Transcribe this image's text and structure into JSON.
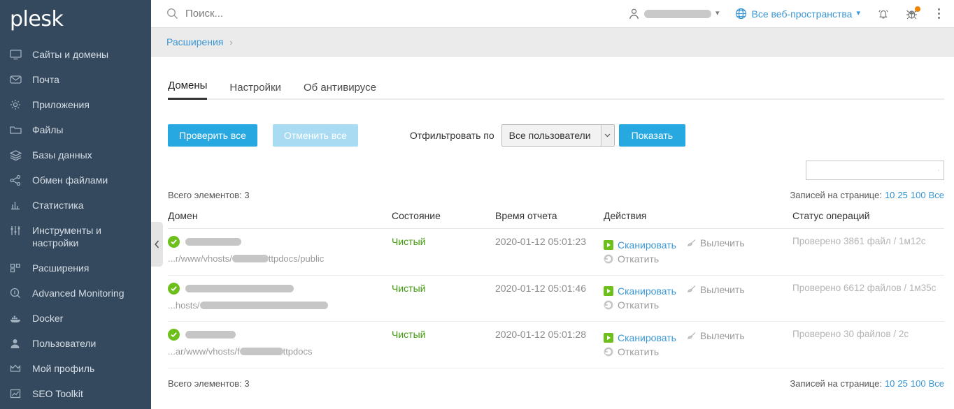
{
  "brand": {
    "name": "plesk"
  },
  "sidebar": {
    "items": [
      {
        "label": "Сайты и домены",
        "icon": "monitor-icon"
      },
      {
        "label": "Почта",
        "icon": "envelope-icon"
      },
      {
        "label": "Приложения",
        "icon": "gear-icon"
      },
      {
        "label": "Файлы",
        "icon": "folder-icon"
      },
      {
        "label": "Базы данных",
        "icon": "database-icon"
      },
      {
        "label": "Обмен файлами",
        "icon": "share-icon"
      },
      {
        "label": "Статистика",
        "icon": "bar-chart-icon"
      },
      {
        "label": "Инструменты и\nнастройки",
        "icon": "sliders-icon"
      },
      {
        "label": "Расширения",
        "icon": "extensions-icon"
      },
      {
        "label": "Advanced Monitoring",
        "icon": "magnifier-circle-icon"
      },
      {
        "label": "Docker",
        "icon": "docker-whale-icon"
      },
      {
        "label": "Пользователи",
        "icon": "user-icon"
      },
      {
        "label": "Мой профиль",
        "icon": "crown-icon"
      },
      {
        "label": "SEO Toolkit",
        "icon": "seo-chart-icon"
      }
    ]
  },
  "topbar": {
    "search_placeholder": "Поиск...",
    "search_value": "",
    "user_redacted": true,
    "webspace_label": "Все веб-пространства",
    "notifications_icon": "bell-icon",
    "bug_icon": "bug-icon",
    "bug_badge": true,
    "more_icon": "kebab-menu-icon"
  },
  "breadcrumb": {
    "items": [
      "Расширения"
    ],
    "separator": "›"
  },
  "tabs": [
    {
      "label": "Домены",
      "active": true
    },
    {
      "label": "Настройки",
      "active": false
    },
    {
      "label": "Об антивирусе",
      "active": false
    }
  ],
  "toolbar": {
    "check_all_label": "Проверить все",
    "cancel_all_label": "Отменить все",
    "filter_label": "Отфильтровать по",
    "filter_value": "Все пользователи",
    "filter_options": [
      "Все пользователи"
    ],
    "show_label": "Показать"
  },
  "list_search": {
    "value": "",
    "placeholder": ""
  },
  "counts": {
    "top_total": "Всего элементов: 3",
    "bottom_total": "Всего элементов: 3",
    "per_page_label": "Записей на странице:",
    "per_page_options": [
      "10",
      "25",
      "100",
      "Все"
    ]
  },
  "table": {
    "headers": [
      "Домен",
      "Состояние",
      "Время отчета",
      "Действия",
      "Статус операций"
    ],
    "rows": [
      {
        "status_icon": "check-circle-icon",
        "domain_redacted_width": 80,
        "path_prefix": "...r/www/vhosts/",
        "path_redacted_width": 52,
        "path_suffix": "ttpdocs/public",
        "state": "Чистый",
        "report_time": "2020-01-12 05:01:23",
        "actions": [
          {
            "label": "Сканировать",
            "icon": "play-icon",
            "enabled": true
          },
          {
            "label": "Вылечить",
            "icon": "brush-icon",
            "enabled": false
          },
          {
            "label": "Откатить",
            "icon": "rollback-icon",
            "enabled": false
          }
        ],
        "operation_status": "Проверено 3861 файл / 1м12с"
      },
      {
        "status_icon": "check-circle-icon",
        "domain_redacted_width": 155,
        "path_prefix": "...hosts/",
        "path_redacted_width": 183,
        "path_suffix": "",
        "state": "Чистый",
        "report_time": "2020-01-12 05:01:46",
        "actions": [
          {
            "label": "Сканировать",
            "icon": "play-icon",
            "enabled": true
          },
          {
            "label": "Вылечить",
            "icon": "brush-icon",
            "enabled": false
          },
          {
            "label": "Откатить",
            "icon": "rollback-icon",
            "enabled": false
          }
        ],
        "operation_status": "Проверено 6612 файлов / 1м35с"
      },
      {
        "status_icon": "check-circle-icon",
        "domain_redacted_width": 72,
        "path_prefix": "...ar/www/vhosts/f",
        "path_redacted_width": 62,
        "path_suffix": "ttpdocs",
        "state": "Чистый",
        "report_time": "2020-01-12 05:01:28",
        "actions": [
          {
            "label": "Сканировать",
            "icon": "play-icon",
            "enabled": true
          },
          {
            "label": "Вылечить",
            "icon": "brush-icon",
            "enabled": false
          },
          {
            "label": "Откатить",
            "icon": "rollback-icon",
            "enabled": false
          }
        ],
        "operation_status": "Проверено 30 файлов / 2с"
      }
    ]
  },
  "colors": {
    "sidebar_bg": "#34495e",
    "accent_blue": "#28a8e0",
    "link_blue": "#3b97d3",
    "clean_green": "#3f9b0b",
    "icon_green": "#6dc01c",
    "badge_orange": "#f28500"
  }
}
